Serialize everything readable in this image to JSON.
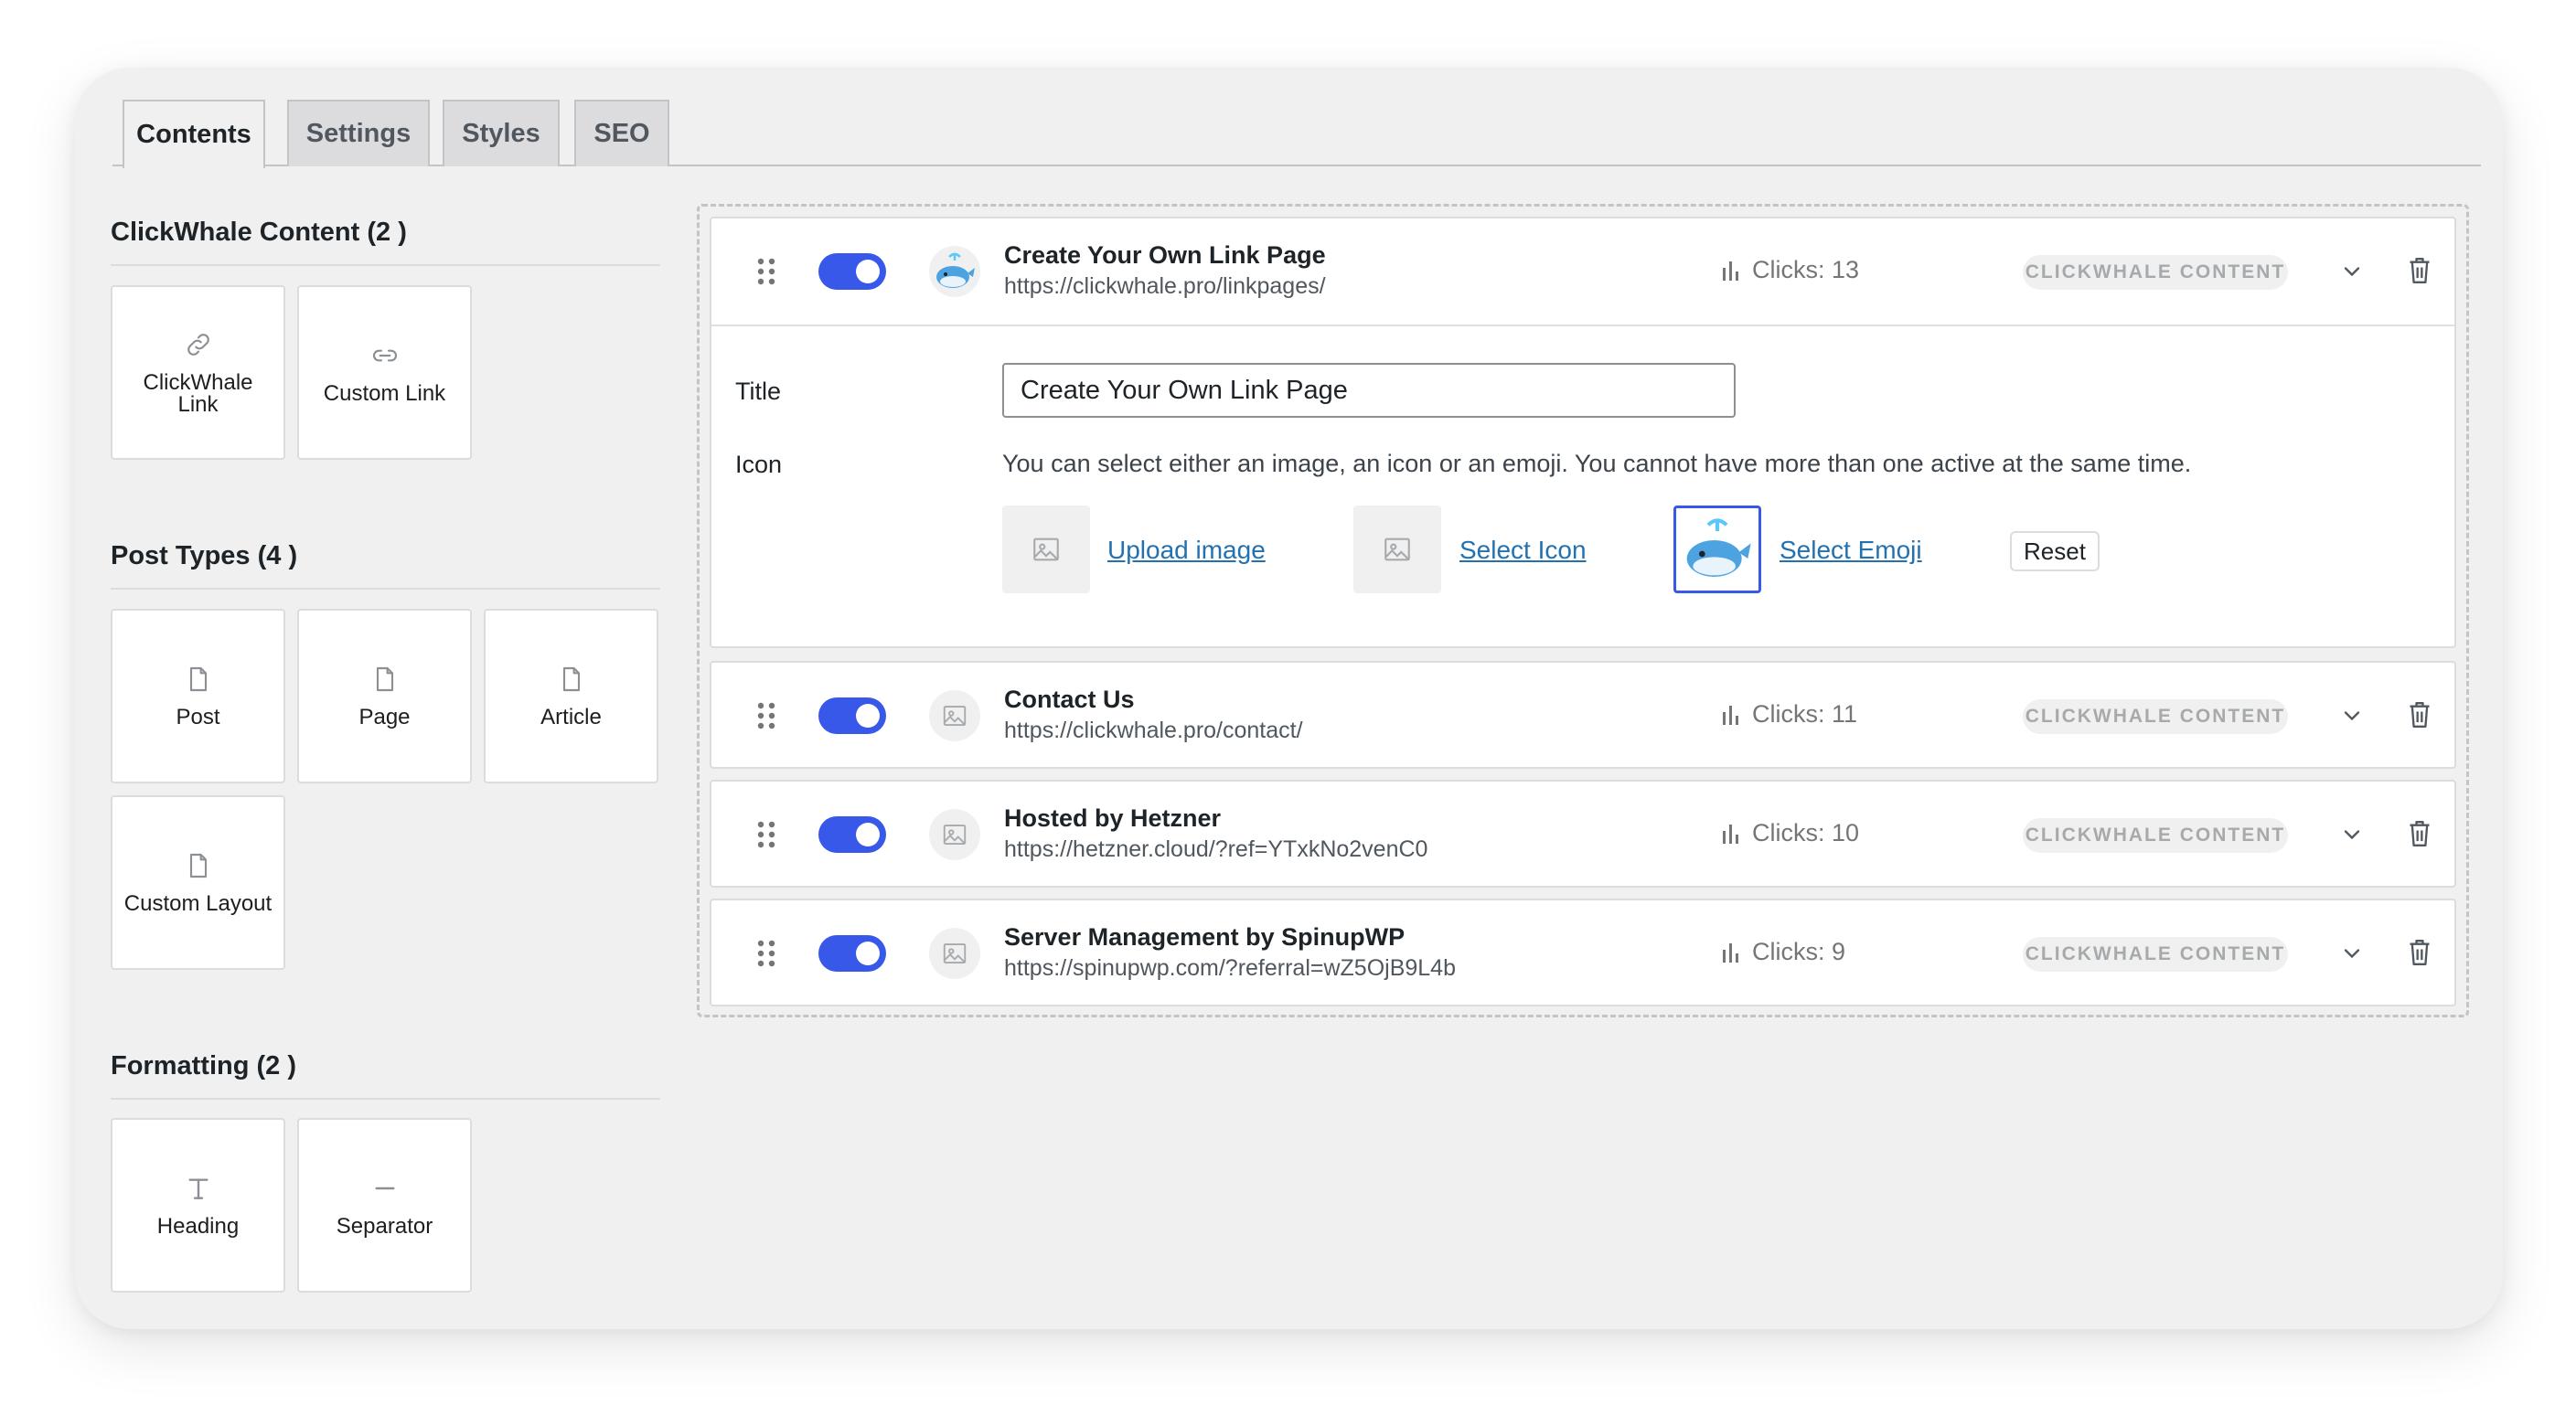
{
  "tabs": [
    {
      "label": "Contents",
      "active": true
    },
    {
      "label": "Settings",
      "active": false
    },
    {
      "label": "Styles",
      "active": false
    },
    {
      "label": "SEO",
      "active": false
    }
  ],
  "sidebar": {
    "sections": [
      {
        "title": "ClickWhale Content (2 )",
        "blocks": [
          {
            "label": "ClickWhale Link",
            "icon": "link-icon"
          },
          {
            "label": "Custom Link",
            "icon": "chain-link-icon"
          }
        ]
      },
      {
        "title": "Post Types (4 )",
        "blocks": [
          {
            "label": "Post",
            "icon": "document-icon"
          },
          {
            "label": "Page",
            "icon": "document-icon"
          },
          {
            "label": "Article",
            "icon": "document-icon"
          },
          {
            "label": "Custom Layout",
            "icon": "document-icon"
          }
        ]
      },
      {
        "title": "Formatting (2 )",
        "blocks": [
          {
            "label": "Heading",
            "icon": "heading-t-icon"
          },
          {
            "label": "Separator",
            "icon": "separator-icon"
          }
        ]
      }
    ]
  },
  "items": [
    {
      "title": "Create Your Own Link Page",
      "url": "https://clickwhale.pro/linkpages/",
      "clicks": "Clicks: 13",
      "badge": "CLICKWHALE CONTENT",
      "enabled": true,
      "icon": "whale-emoji",
      "expanded": true
    },
    {
      "title": "Contact Us",
      "url": "https://clickwhale.pro/contact/",
      "clicks": "Clicks: 11",
      "badge": "CLICKWHALE CONTENT",
      "enabled": true,
      "icon": "image-placeholder-icon"
    },
    {
      "title": "Hosted by Hetzner",
      "url": "https://hetzner.cloud/?ref=YTxkNo2venC0",
      "clicks": "Clicks: 10",
      "badge": "CLICKWHALE CONTENT",
      "enabled": true,
      "icon": "image-placeholder-icon"
    },
    {
      "title": "Server Management by SpinupWP",
      "url": "https://spinupwp.com/?referral=wZ5OjB9L4b",
      "clicks": "Clicks: 9",
      "badge": "CLICKWHALE CONTENT",
      "enabled": true,
      "icon": "image-placeholder-icon"
    }
  ],
  "editor": {
    "title_label": "Title",
    "title_value": "Create Your Own Link Page",
    "icon_label": "Icon",
    "icon_help": "You can select either an image, an icon or an emoji. You cannot have more than one active at the same time.",
    "upload_image": "Upload image",
    "select_icon": "Select Icon",
    "select_emoji": "Select Emoji",
    "reset": "Reset"
  },
  "colors": {
    "accent": "#3858e9",
    "link": "#2271b1",
    "background": "#f0f0f0"
  }
}
